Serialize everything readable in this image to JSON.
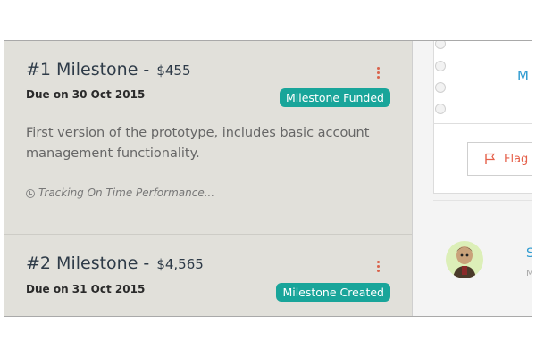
{
  "milestones": [
    {
      "title": "#1 Milestone - ",
      "amount": "$455",
      "due": "Due on 30 Oct 2015",
      "status": "Milestone Funded",
      "description": "First version of the prototype, includes basic account management functionality.",
      "tracking": "Tracking On Time Performance..."
    },
    {
      "title": "#2 Milestone - ",
      "amount": "$4,565",
      "due": "Due on 31 Oct 2015",
      "status": "Milestone Created"
    }
  ],
  "right_panel": {
    "partial_label": "M",
    "flag_label": "Flag",
    "user_initial": "S",
    "user_sub": "M"
  },
  "colors": {
    "badge": "#19a59a",
    "kebab": "#d9634c",
    "flag": "#e5604a",
    "link": "#2e9bd1"
  },
  "icons": [
    "more-vertical-icon",
    "clock-icon",
    "flag-icon",
    "radio-icon",
    "avatar"
  ]
}
